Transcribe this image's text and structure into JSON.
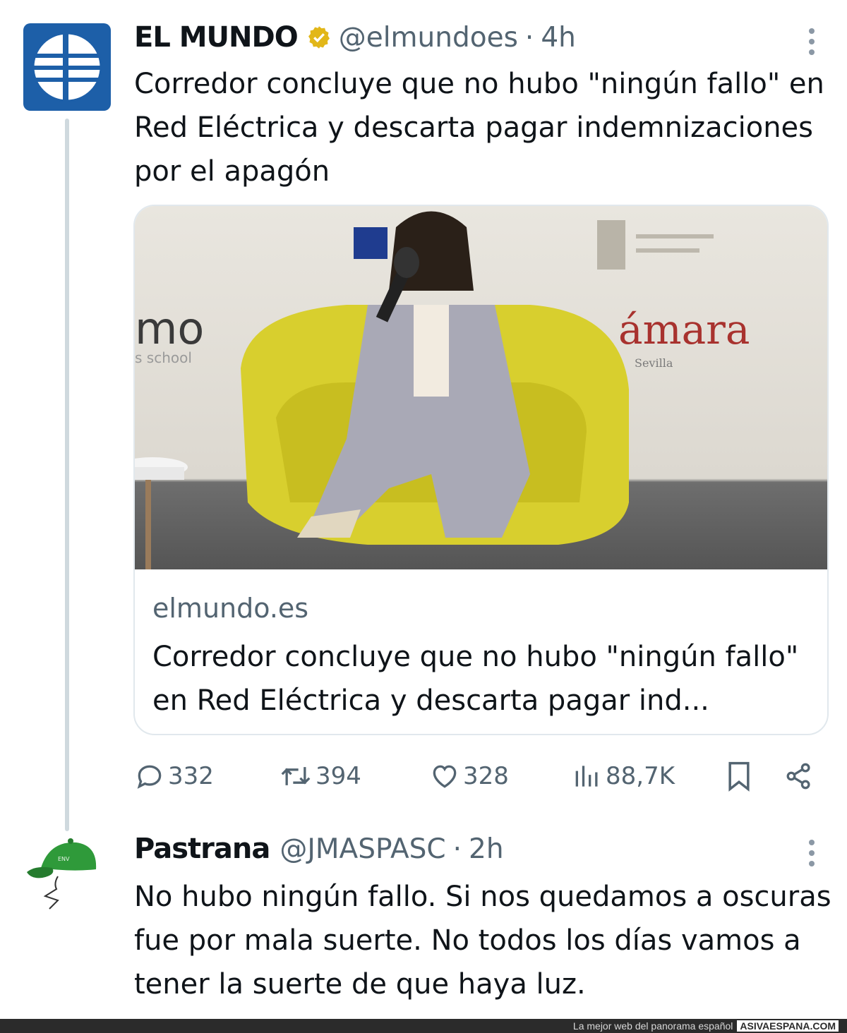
{
  "tweet": {
    "author_name": "EL MUNDO",
    "handle": "@elmundoes",
    "separator": "·",
    "time": "4h",
    "text": "Corredor concluye que no hubo \"ningún fallo\" en Red Eléctrica y descarta pagar indemnizaciones por el apagón",
    "card": {
      "domain": "elmundo.es",
      "title": "Corredor concluye que no hubo \"ningún fallo\" en Red Eléctrica y descarta pagar ind...",
      "image_banner_left": "mo",
      "image_banner_left_sub": "s school",
      "image_banner_right": "ámara",
      "image_banner_right_sub": "Sevilla"
    },
    "actions": {
      "replies": "332",
      "retweets": "394",
      "likes": "328",
      "views": "88,7K"
    }
  },
  "reply": {
    "author_name": "Pastrana",
    "handle": "@JMASPASC",
    "separator": "·",
    "time": "2h",
    "text": "No hubo ningún fallo. Si nos quedamos a oscuras fue por mala suerte. No todos los días vamos a tener la suerte de que haya luz."
  },
  "footer": {
    "tagline": "La mejor web del panorama español",
    "brand": "ASIVAESPANA.COM"
  },
  "colors": {
    "verified": "#e2b719",
    "elmundo_blue": "#1d5fa8",
    "muted": "#536471",
    "chair": "#d8cf2e",
    "cap": "#2f9a3a"
  },
  "icons": [
    "verified-badge-icon",
    "more-icon",
    "reply-icon",
    "retweet-icon",
    "like-icon",
    "views-icon",
    "bookmark-icon",
    "share-icon",
    "elmundo-globe-icon",
    "green-cap-icon"
  ]
}
